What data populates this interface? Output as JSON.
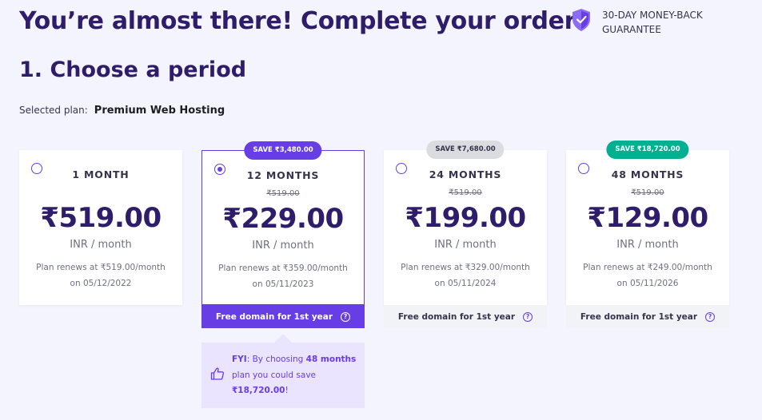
{
  "header": {
    "title": "You’re almost there! Complete your order",
    "guarantee_line1": "30-DAY MONEY-BACK",
    "guarantee_line2": "GUARANTEE"
  },
  "section": {
    "title": "1. Choose a period",
    "selected_plan_label": "Selected plan:",
    "selected_plan_name": "Premium Web Hosting"
  },
  "plans": [
    {
      "period": "1 MONTH",
      "badge": "",
      "old_price": "",
      "price": "₹519.00",
      "unit": "INR / month",
      "renew_line1": "Plan renews at ₹519.00/month",
      "renew_line2": "on 05/12/2022",
      "domain": "",
      "selected": false
    },
    {
      "period": "12 MONTHS",
      "badge": "SAVE ₹3,480.00",
      "old_price": "₹519.00",
      "price": "₹229.00",
      "unit": "INR / month",
      "renew_line1": "Plan renews at ₹359.00/month",
      "renew_line2": "on 05/11/2023",
      "domain": "Free domain for 1st year",
      "selected": true
    },
    {
      "period": "24 MONTHS",
      "badge": "SAVE ₹7,680.00",
      "old_price": "₹519.00",
      "price": "₹199.00",
      "unit": "INR / month",
      "renew_line1": "Plan renews at ₹329.00/month",
      "renew_line2": "on 05/11/2024",
      "domain": "Free domain for 1st year",
      "selected": false
    },
    {
      "period": "48 MONTHS",
      "badge": "SAVE ₹18,720.00",
      "old_price": "₹519.00",
      "price": "₹129.00",
      "unit": "INR / month",
      "renew_line1": "Plan renews at ₹249.00/month",
      "renew_line2": "on 05/11/2026",
      "domain": "Free domain for 1st year",
      "selected": false
    }
  ],
  "fyi": {
    "prefix": "FYI",
    "text1": ": By choosing ",
    "highlight_period": "48 months",
    "text2": " plan you could save ",
    "highlight_amount": "₹18,720.00",
    "suffix": "!"
  },
  "colors": {
    "brand": "#673de6",
    "heading": "#2f1c6a",
    "save_green": "#00b090",
    "save_gray": "#dadce0"
  }
}
